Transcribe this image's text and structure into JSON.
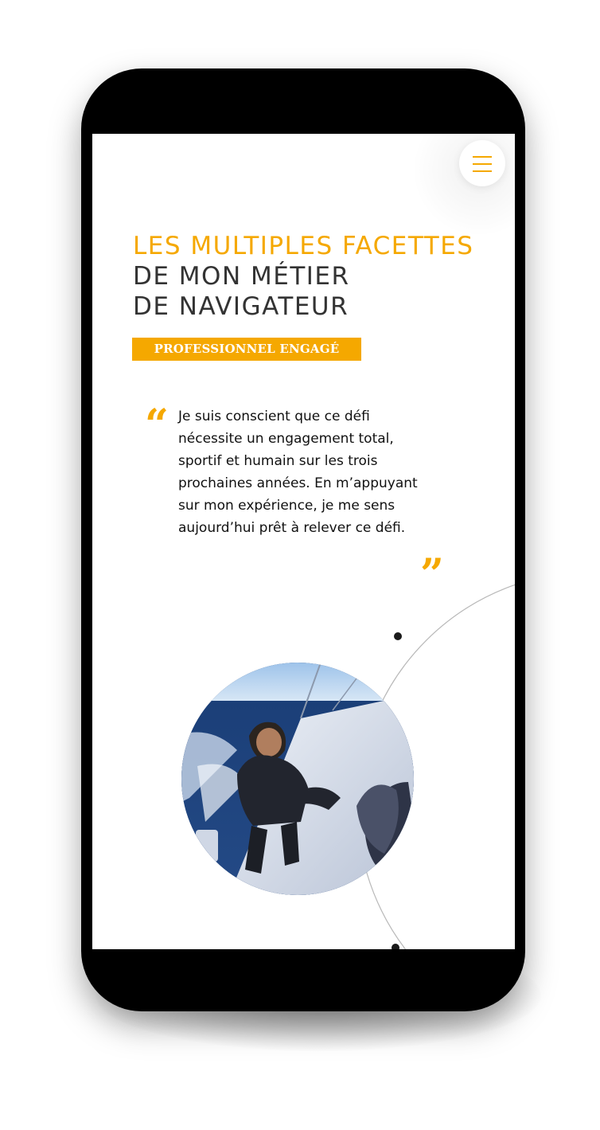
{
  "header": {
    "menu_icon": "hamburger-menu-icon"
  },
  "hero": {
    "title_line_1": "LES MULTIPLES FACETTES",
    "title_line_2": "DE MON MÉTIER",
    "title_line_3": "DE NAVIGATEUR",
    "badge": "PROFESSIONNEL ENGAGÉ"
  },
  "quote": {
    "open_mark": "“",
    "text": "Je suis conscient que ce défi nécessite un engagement total, sportif et humain sur les trois prochaines années. En m’appuyant sur mon expérience, je me sens aujourd’hui prêt à relever ce défi.",
    "close_mark": "”"
  },
  "photo": {
    "subject": "sailor-on-boat-photo"
  },
  "colors": {
    "accent": "#f5a800",
    "text": "#333333",
    "frame": "#000000"
  }
}
